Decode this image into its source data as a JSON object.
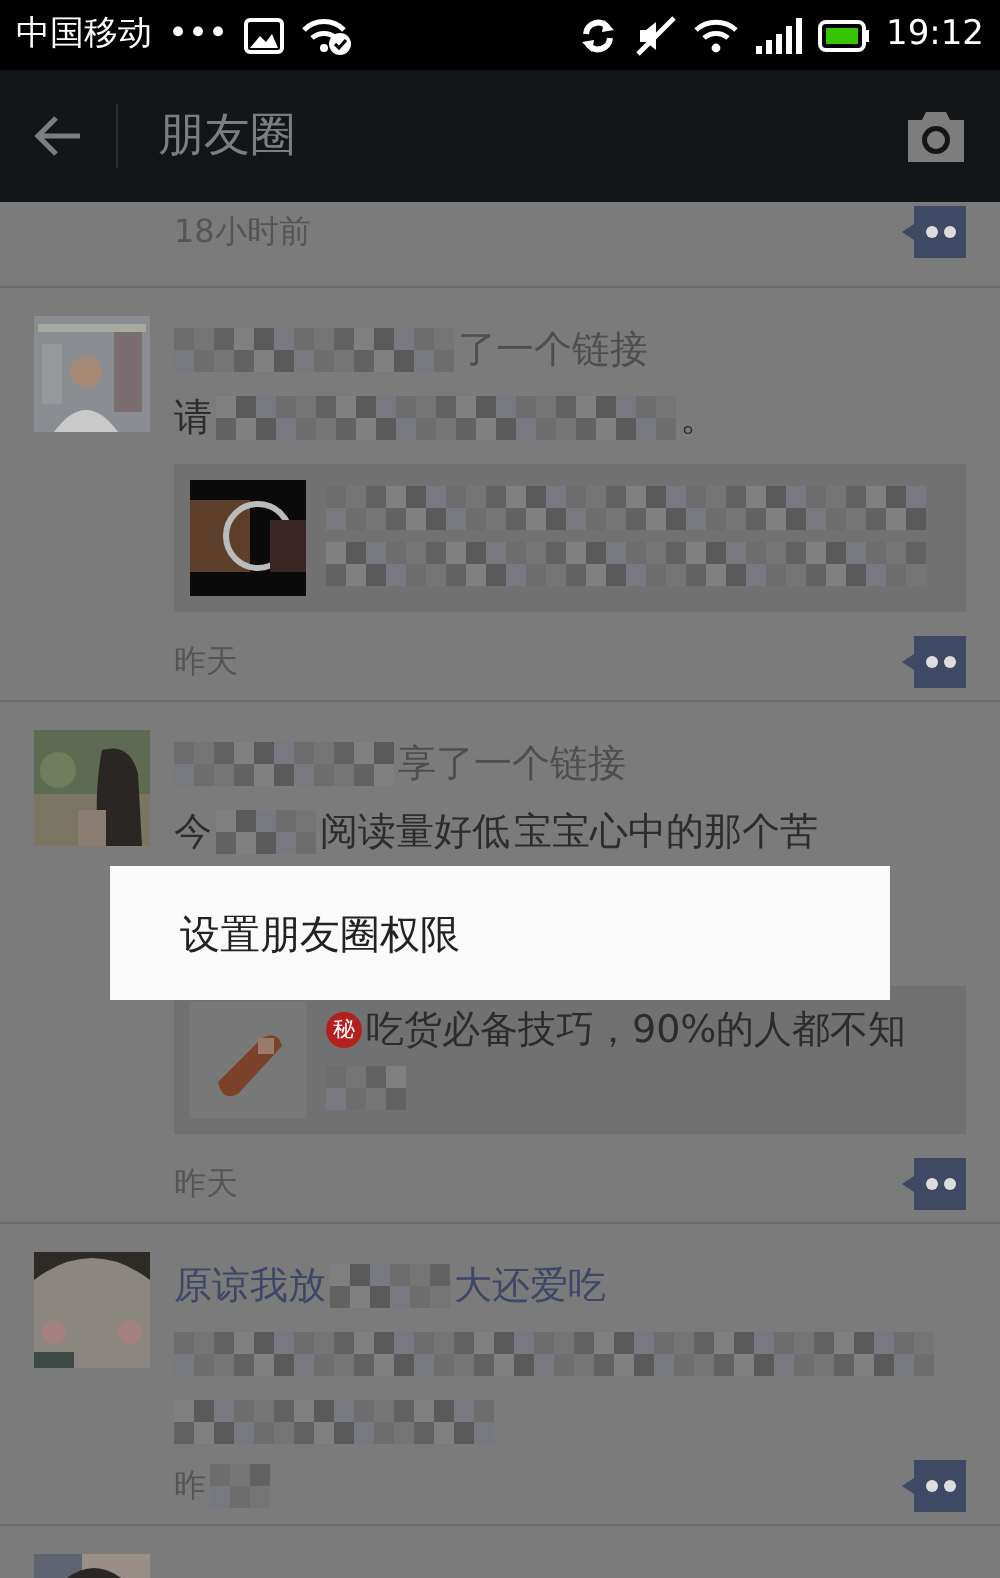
{
  "status_bar": {
    "carrier": "中国移动",
    "dots": "•••",
    "time": "19:12"
  },
  "nav": {
    "title": "朋友圈"
  },
  "posts": [
    {
      "time": [
        {
          "kind": "time",
          "text": "18小时前"
        }
      ]
    },
    {
      "avatar": {
        "kind": "picture"
      },
      "header": [
        {
          "kind": "mosaic"
        },
        {
          "kind": "action",
          "text": "了一个链接"
        }
      ],
      "content": [
        [
          {
            "kind": "text",
            "text": "请"
          },
          {
            "kind": "mosaic"
          },
          {
            "kind": "text",
            "text": "。"
          }
        ]
      ],
      "link": {
        "thumbnail": {
          "kind": "picture"
        },
        "lines": [
          [
            {
              "kind": "mosaic"
            }
          ],
          [
            {
              "kind": "mosaic"
            }
          ]
        ]
      },
      "time": [
        {
          "kind": "time",
          "text": "昨天"
        }
      ]
    },
    {
      "avatar": {
        "kind": "picture"
      },
      "header": [
        {
          "kind": "mosaic"
        },
        {
          "kind": "action",
          "text": "享了一个链接"
        }
      ],
      "content": [
        [
          {
            "kind": "text",
            "text": "今"
          },
          {
            "kind": "mosaic"
          },
          {
            "kind": "text",
            "text": "阅读量好低"
          },
          {
            "kind": "text",
            "text": "宝宝心中的那个苦"
          }
        ]
      ],
      "link": {
        "thumbnail": {
          "kind": "picture"
        },
        "badge": "秘",
        "lines": [
          [
            {
              "kind": "text",
              "text": "吃货必备技巧，90%的人都不知"
            }
          ],
          [
            {
              "kind": "mosaic"
            }
          ]
        ]
      },
      "time": [
        {
          "kind": "time",
          "text": "昨天"
        }
      ]
    },
    {
      "avatar": {
        "kind": "picture"
      },
      "header": [
        {
          "kind": "name",
          "text": "原谅我放"
        },
        {
          "kind": "mosaic"
        },
        {
          "kind": "name",
          "text": "大还爱吃"
        }
      ],
      "content": [
        [
          {
            "kind": "mosaic"
          }
        ],
        [
          {
            "kind": "mosaic"
          }
        ]
      ],
      "time": [
        {
          "kind": "time",
          "text": "昨"
        },
        {
          "kind": "mosaic"
        }
      ]
    },
    {
      "avatar": {
        "kind": "picture"
      }
    }
  ],
  "popup": {
    "items": [
      "设置朋友圈权限"
    ]
  }
}
